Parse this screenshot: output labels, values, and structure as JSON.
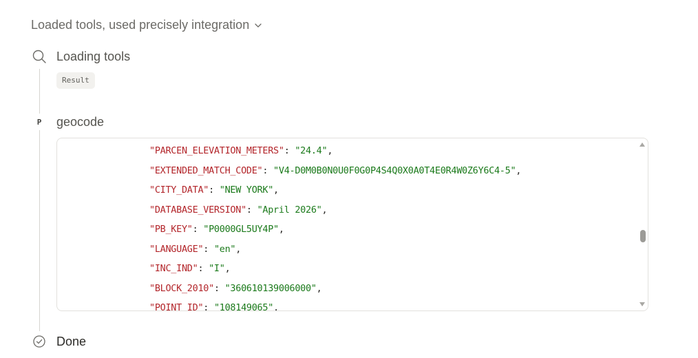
{
  "header": {
    "title": "Loaded tools, used precisely integration",
    "icon": "chevron-down-icon"
  },
  "steps": {
    "loading": {
      "label": "Loading tools",
      "icon": "search-icon",
      "result_label": "Result"
    },
    "geocode": {
      "label": "geocode",
      "badge": "P"
    },
    "done": {
      "label": "Done",
      "icon": "check-circle-icon"
    }
  },
  "code": {
    "lines": [
      {
        "key": "\"PARCEN_ELEVATION_METERS\"",
        "value": "\"24.4\""
      },
      {
        "key": "\"EXTENDED_MATCH_CODE\"",
        "value": "\"V4-D0M0B0N0U0F0G0P4S4Q0X0A0T4E0R4W0Z6Y6C4-5\""
      },
      {
        "key": "\"CITY_DATA\"",
        "value": "\"NEW YORK\""
      },
      {
        "key": "\"DATABASE_VERSION\"",
        "value": "\"April 2026\""
      },
      {
        "key": "\"PB_KEY\"",
        "value": "\"P0000GL5UY4P\""
      },
      {
        "key": "\"LANGUAGE\"",
        "value": "\"en\""
      },
      {
        "key": "\"INC_IND\"",
        "value": "\"I\""
      },
      {
        "key": "\"BLOCK_2010\"",
        "value": "\"360610139006000\""
      },
      {
        "key": "\"POINT_ID\"",
        "value": "\"108149065\""
      }
    ],
    "separator": ": ",
    "comma": ","
  },
  "colors": {
    "key": "#b3262b",
    "value": "#1b7a1b",
    "muted_text": "#6b6a66"
  }
}
